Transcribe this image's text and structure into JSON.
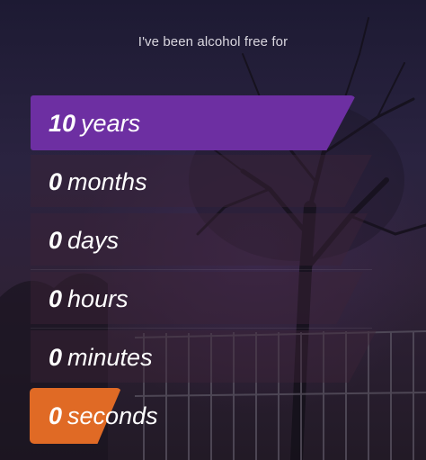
{
  "colors": {
    "years_highlight": "#6d2fa2",
    "seconds_highlight": "#e06a25",
    "text": "#ffffff"
  },
  "subtitle": "I've been alcohol free for",
  "counter": [
    {
      "value": "10",
      "unit": "years",
      "highlight": "purple"
    },
    {
      "value": "0",
      "unit": "months"
    },
    {
      "value": "0",
      "unit": "days"
    },
    {
      "value": "0",
      "unit": "hours"
    },
    {
      "value": "0",
      "unit": "minutes"
    },
    {
      "value": "0",
      "unit": "seconds",
      "highlight": "orange"
    }
  ]
}
